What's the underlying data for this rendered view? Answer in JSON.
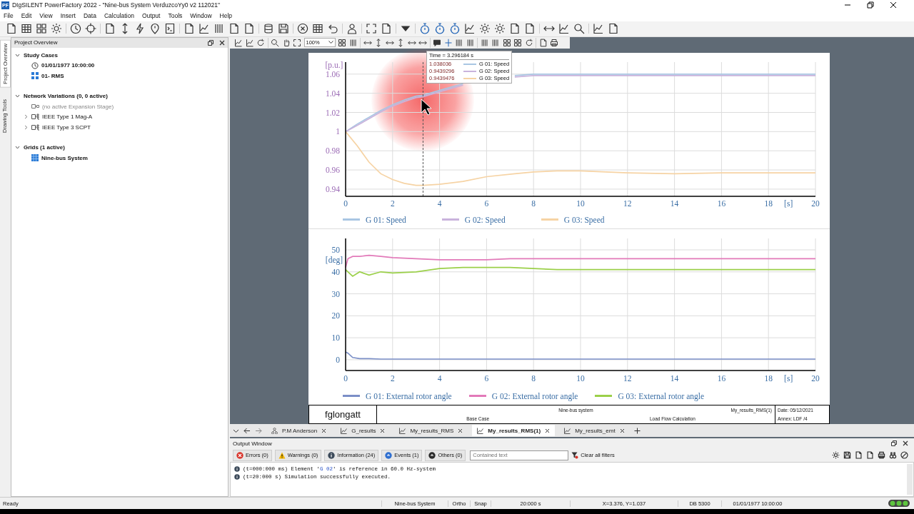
{
  "window": {
    "app_icon": "PF",
    "title": "DIgSILENT PowerFactory 2022  - \"Nine-bus System VerduzcoYy0 v2 112021\""
  },
  "menu": [
    "File",
    "Edit",
    "View",
    "Insert",
    "Data",
    "Calculation",
    "Output",
    "Tools",
    "Window",
    "Help"
  ],
  "zoom_select": {
    "value": "100%"
  },
  "side_tabs": [
    {
      "label": "Project Overview",
      "selected": true
    },
    {
      "label": "Drawing Tools",
      "selected": false
    }
  ],
  "project_overview": {
    "title": "Project Overview",
    "sections": [
      {
        "label": "Study Cases",
        "expanded": true,
        "children": [
          {
            "label": "01/01/1977 10:00:00",
            "kind": "clock",
            "active": true
          },
          {
            "label": "01- RMS",
            "kind": "study",
            "active": true
          }
        ]
      },
      {
        "label": "Network Variations (0, 0 active)",
        "expanded": true,
        "children": [
          {
            "label": "(no active Expansion Stage)",
            "kind": "stage",
            "active": false
          },
          {
            "label": "IEEE Type 1 Mag-A",
            "kind": "variation",
            "active": false
          },
          {
            "label": "IEEE Type 3 SCPT",
            "kind": "variation",
            "active": false
          }
        ]
      },
      {
        "label": "Grids (1 active)",
        "expanded": true,
        "children": [
          {
            "label": "Nine-bus System",
            "kind": "grid",
            "active": true
          }
        ]
      }
    ]
  },
  "plots": [
    {
      "chart_data": {
        "type": "line",
        "ylabel": "[p.u.]",
        "xlabel": "[s]",
        "x": [
          0,
          0.5,
          1,
          1.5,
          2,
          2.5,
          3,
          3.3,
          4,
          5,
          6,
          7.2,
          8,
          9,
          10,
          12,
          14,
          16,
          18,
          20
        ],
        "xlim": [
          0,
          20
        ],
        "ylim": [
          0.9325,
          1.0725
        ],
        "xticks": [
          0,
          2,
          4,
          6,
          8,
          10,
          12,
          14,
          16,
          18,
          20
        ],
        "yticks": [
          0.94,
          0.96,
          0.98,
          1,
          1.02,
          1.04,
          1.06
        ],
        "series": [
          {
            "name": "G 01: Speed",
            "color": "#a9c6e3",
            "values": [
              1,
              1.008,
              1.015,
              1.022,
              1.028,
              1.033,
              1.037,
              1.038,
              1.043,
              1.05,
              null,
              1.0585,
              1.06,
              1.06,
              1.06,
              1.06,
              1.06,
              1.06,
              1.06,
              1.06
            ]
          },
          {
            "name": "G 02: Speed",
            "color": "#c9b3dc",
            "values": [
              1,
              1.0065,
              1.0135,
              1.0205,
              1.0265,
              1.0315,
              1.0355,
              1.0365,
              1.0415,
              1.0485,
              null,
              1.057,
              1.0585,
              1.0585,
              1.0585,
              1.0585,
              1.0585,
              1.0585,
              1.0585,
              1.0585
            ]
          },
          {
            "name": "G 03: Speed",
            "color": "#f6d3a4",
            "values": [
              1,
              0.985,
              0.968,
              0.956,
              0.95,
              0.946,
              0.944,
              0.944,
              0.945,
              0.948,
              0.953,
              0.956,
              0.958,
              0.959,
              0.959,
              0.957,
              0.956,
              0.957,
              0.957,
              0.957
            ]
          }
        ],
        "grid": true,
        "ref_lines": [
          {
            "axis": "x",
            "value": 3.296184
          }
        ]
      },
      "cursor_tooltip": {
        "title": "Time = 3.296184 s",
        "rows": [
          {
            "value": "1.038036",
            "label": "G 01: Speed",
            "color": "#a9c6e3"
          },
          {
            "value": "0.9439296",
            "label": "G 02: Speed",
            "color": "#c9b3dc"
          },
          {
            "value": "0.9439476",
            "label": "G 03: Speed",
            "color": "#f6d3a4"
          }
        ]
      }
    },
    {
      "chart_data": {
        "type": "line",
        "ylabel": "[deg]",
        "xlabel": "[s]",
        "x": [
          0,
          0.1,
          0.3,
          0.6,
          1,
          1.5,
          2,
          3,
          4,
          5,
          6,
          7,
          8,
          9,
          10,
          12,
          14,
          16,
          18,
          20
        ],
        "xlim": [
          0,
          20
        ],
        "ylim": [
          -4.9,
          55.2
        ],
        "grid": true,
        "xticks": [
          0,
          2,
          4,
          6,
          8,
          10,
          12,
          14,
          16,
          18,
          20
        ],
        "yticks": [
          0,
          10,
          20,
          30,
          40,
          50
        ],
        "series": [
          {
            "name": "G 01: External rotor angle",
            "color": "#7b8fc7",
            "values": [
              3.5,
              3,
              1,
              0.5,
              0.5,
              0.3,
              0.3,
              0.3,
              0.3,
              0.3,
              0.3,
              0.3,
              0.3,
              0.3,
              0.3,
              0.3,
              0.3,
              0.3,
              0.3,
              0.3
            ]
          },
          {
            "name": "G 02: External rotor angle",
            "color": "#e27ab9",
            "values": [
              42,
              46,
              47,
              47,
              47.5,
              47,
              46.5,
              46,
              45.5,
              45.5,
              45.5,
              46,
              46,
              46,
              46,
              46,
              46,
              46,
              46,
              46
            ]
          },
          {
            "name": "G 03: External rotor angle",
            "color": "#9bd049",
            "values": [
              41,
              40,
              38,
              40,
              38.5,
              40,
              39.5,
              40,
              41.5,
              42,
              42,
              42,
              41.5,
              41,
              41,
              41,
              41,
              41,
              41,
              41
            ]
          }
        ]
      }
    }
  ],
  "title_block": {
    "author": "fglongatt",
    "project": "Nine-bus system",
    "page": "My_results_RMS(1)",
    "case": "Base Case",
    "calculation": "Load Flow Calculation",
    "date": "Date: 05/12/2021",
    "annex": "Annex: LDF /4"
  },
  "doc_tabs": [
    {
      "label": "P.M Anderson",
      "kind": "diagram",
      "selected": false
    },
    {
      "label": "G_results",
      "kind": "plot",
      "selected": false
    },
    {
      "label": "My_results_RMS",
      "kind": "plot",
      "selected": false
    },
    {
      "label": "My_results_RMS(1)",
      "kind": "plot",
      "selected": true
    },
    {
      "label": "My_results_emt",
      "kind": "plot",
      "selected": false
    }
  ],
  "output": {
    "title": "Output Window",
    "filters": [
      {
        "label": "Errors (0)",
        "kind": "error"
      },
      {
        "label": "Warnings (0)",
        "kind": "warning"
      },
      {
        "label": "Information (24)",
        "kind": "info"
      },
      {
        "label": "Events (1)",
        "kind": "event"
      },
      {
        "label": "Others (0)",
        "kind": "other"
      }
    ],
    "search": {
      "placeholder": "Contained text"
    },
    "clear_filters": "Clear all filters",
    "messages": [
      {
        "before": "(t=000:000 ms) Element '",
        "link": "G 02",
        "after": "' is reference in 60.0 Hz-system"
      },
      {
        "before": "(t=20:000 s) Simulation successfully executed."
      }
    ]
  },
  "status_bar": {
    "ready": "Ready",
    "fields": [
      "Nine-bus System",
      "Ortho",
      "Snap",
      "20:000 s",
      "X=3.376, Y=1.037",
      "DB 5300",
      "01/01/1977 10:00:00"
    ]
  }
}
